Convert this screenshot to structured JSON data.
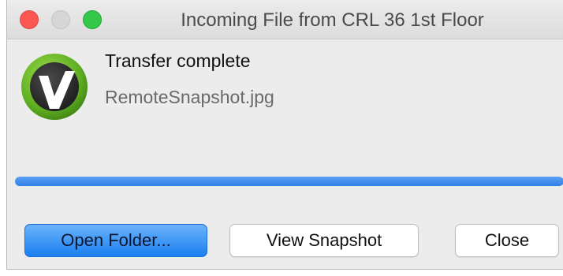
{
  "window": {
    "title": "Incoming File from CRL 36 1st Floor",
    "controls": [
      "close-button",
      "minimize-button",
      "zoom-button"
    ]
  },
  "transfer": {
    "status": "Transfer complete",
    "filename": "RemoteSnapshot.jpg",
    "progress_percent": 100,
    "app_icon": "green-v-logo-icon"
  },
  "buttons": {
    "open_folder": "Open Folder...",
    "view_snapshot": "View Snapshot",
    "close": "Close"
  },
  "colors": {
    "progress": "#2f7fe6",
    "default_button": "#1a7ff0",
    "close_control": "#fc5753",
    "zoom_control": "#34c84a",
    "logo_green": "#6fbf2e"
  }
}
